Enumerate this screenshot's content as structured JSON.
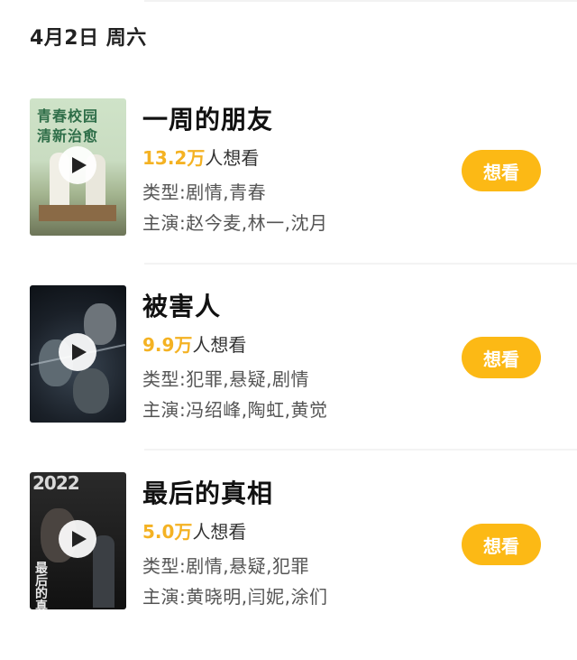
{
  "header": {
    "date": "4月2日 周六"
  },
  "movies": [
    {
      "title": "一周的朋友",
      "wish_num": "13.2万",
      "wish_suffix": "人想看",
      "genre": "类型:剧情,青春",
      "cast": "主演:赵今麦,林一,沈月",
      "button": "想看",
      "poster_line1": "青春校园",
      "poster_line2": "清新治愈"
    },
    {
      "title": "被害人",
      "wish_num": "9.9万",
      "wish_suffix": "人想看",
      "genre": "类型:犯罪,悬疑,剧情",
      "cast": "主演:冯绍峰,陶虹,黄觉",
      "button": "想看"
    },
    {
      "title": "最后的真相",
      "wish_num": "5.0万",
      "wish_suffix": "人想看",
      "genre": "类型:剧情,悬疑,犯罪",
      "cast": "主演:黄晓明,闫妮,涂们",
      "button": "想看",
      "poster_year": "2022",
      "poster_title": "最后的真相"
    }
  ],
  "colors": {
    "accent": "#fcb915",
    "wish_number": "#f4b223"
  },
  "icons": {
    "play": "play-icon"
  }
}
